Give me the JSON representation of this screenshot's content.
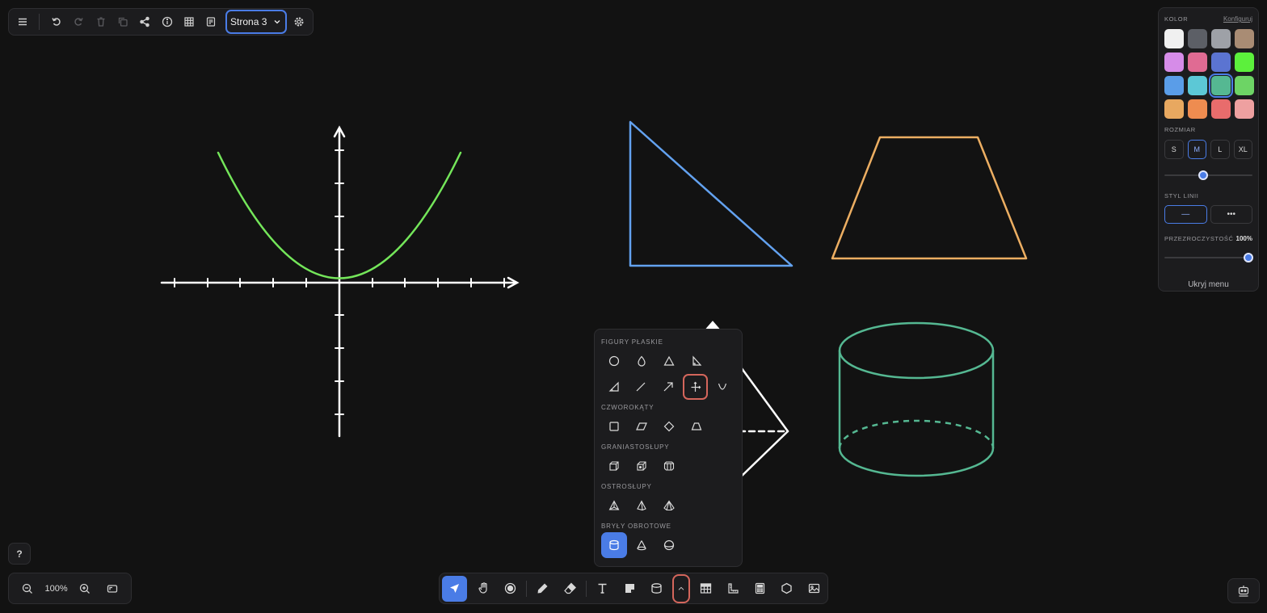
{
  "top_toolbar": {
    "page_selector": "Strona 3"
  },
  "style_panel": {
    "color_title": "KOLOR",
    "customize": "Konfiguruj",
    "colors": [
      "#f0f0f0",
      "#5c5f66",
      "#9ea1a7",
      "#a98c74",
      "#d68ce8",
      "#e06b93",
      "#5b74d1",
      "#5cf03c",
      "#5a9de8",
      "#5cc8d6",
      "#55b892",
      "#6dd465",
      "#e8a860",
      "#ee8c50",
      "#e86c6c",
      "#eea0a0"
    ],
    "selected_color": "#55b892",
    "size_title": "ROZMIAR",
    "sizes": [
      "S",
      "M",
      "L",
      "XL"
    ],
    "selected_size": "M",
    "line_style_title": "STYL LINII",
    "line_styles": [
      "—",
      "•••"
    ],
    "opacity_title": "PRZEZROCZYSTOŚĆ",
    "opacity_value": "100%",
    "hide_menu": "Ukryj menu"
  },
  "shapes_popup": {
    "categories": [
      "FIGURY PŁASKIE",
      "CZWOROKĄTY",
      "GRANIASTOSŁUPY",
      "OSTROSŁUPY",
      "BRYŁY OBROTOWE"
    ]
  },
  "help": {
    "label": "?"
  },
  "zoom": {
    "level": "100%"
  },
  "colors": {
    "accent": "#4a7ce6",
    "highlight": "#d4665c",
    "parabola": "#74e65a",
    "triangle": "#63a2f0",
    "trapezoid": "#ecae62",
    "cylinder": "#55b892"
  }
}
